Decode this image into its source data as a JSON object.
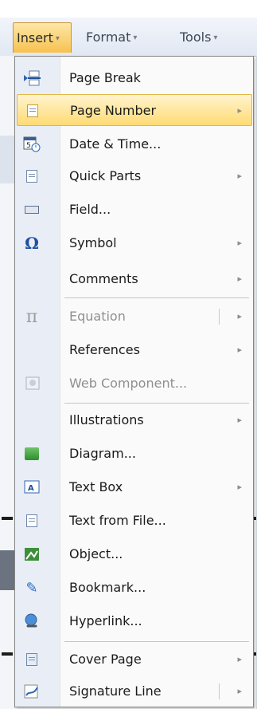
{
  "menubar": {
    "tabs": [
      {
        "label": "Insert",
        "caret": "▾"
      },
      {
        "label": "Format",
        "caret": "▾"
      },
      {
        "label": "Tools",
        "caret": "▾"
      }
    ]
  },
  "insert_menu": {
    "items": [
      {
        "label": "Page Break",
        "icon": "page-break-icon"
      },
      {
        "label": "Page Number",
        "icon": "page-number-icon",
        "submenu": "▸",
        "highlighted": true
      },
      {
        "label": "Date & Time...",
        "icon": "date-time-icon"
      },
      {
        "label": "Quick Parts",
        "icon": "quick-parts-icon",
        "submenu": "▸"
      },
      {
        "label": "Field...",
        "icon": "field-icon"
      },
      {
        "label": "Symbol",
        "icon": "symbol-icon",
        "submenu": "▸"
      },
      {
        "label": "Comments",
        "submenu": "▸"
      },
      {
        "label": "Equation",
        "icon": "equation-icon",
        "submenu": "▸",
        "disabled": true
      },
      {
        "label": "References",
        "submenu": "▸"
      },
      {
        "label": "Web Component...",
        "icon": "web-component-icon",
        "disabled": true
      },
      {
        "label": "Illustrations",
        "submenu": "▸"
      },
      {
        "label": "Diagram...",
        "icon": "diagram-icon"
      },
      {
        "label": "Text Box",
        "icon": "text-box-icon",
        "submenu": "▸"
      },
      {
        "label": "Text from File...",
        "icon": "text-from-file-icon"
      },
      {
        "label": "Object...",
        "icon": "object-icon"
      },
      {
        "label": "Bookmark...",
        "icon": "bookmark-icon"
      },
      {
        "label": "Hyperlink...",
        "icon": "hyperlink-icon"
      },
      {
        "label": "Cover Page",
        "icon": "cover-page-icon",
        "submenu": "▸"
      },
      {
        "label": "Signature Line",
        "icon": "signature-line-icon",
        "submenu": "▸"
      }
    ]
  },
  "colors": {
    "highlight": "#ffdb72",
    "disabled_text": "#8f8f8f",
    "menu_gutter": "#e9eef6"
  }
}
